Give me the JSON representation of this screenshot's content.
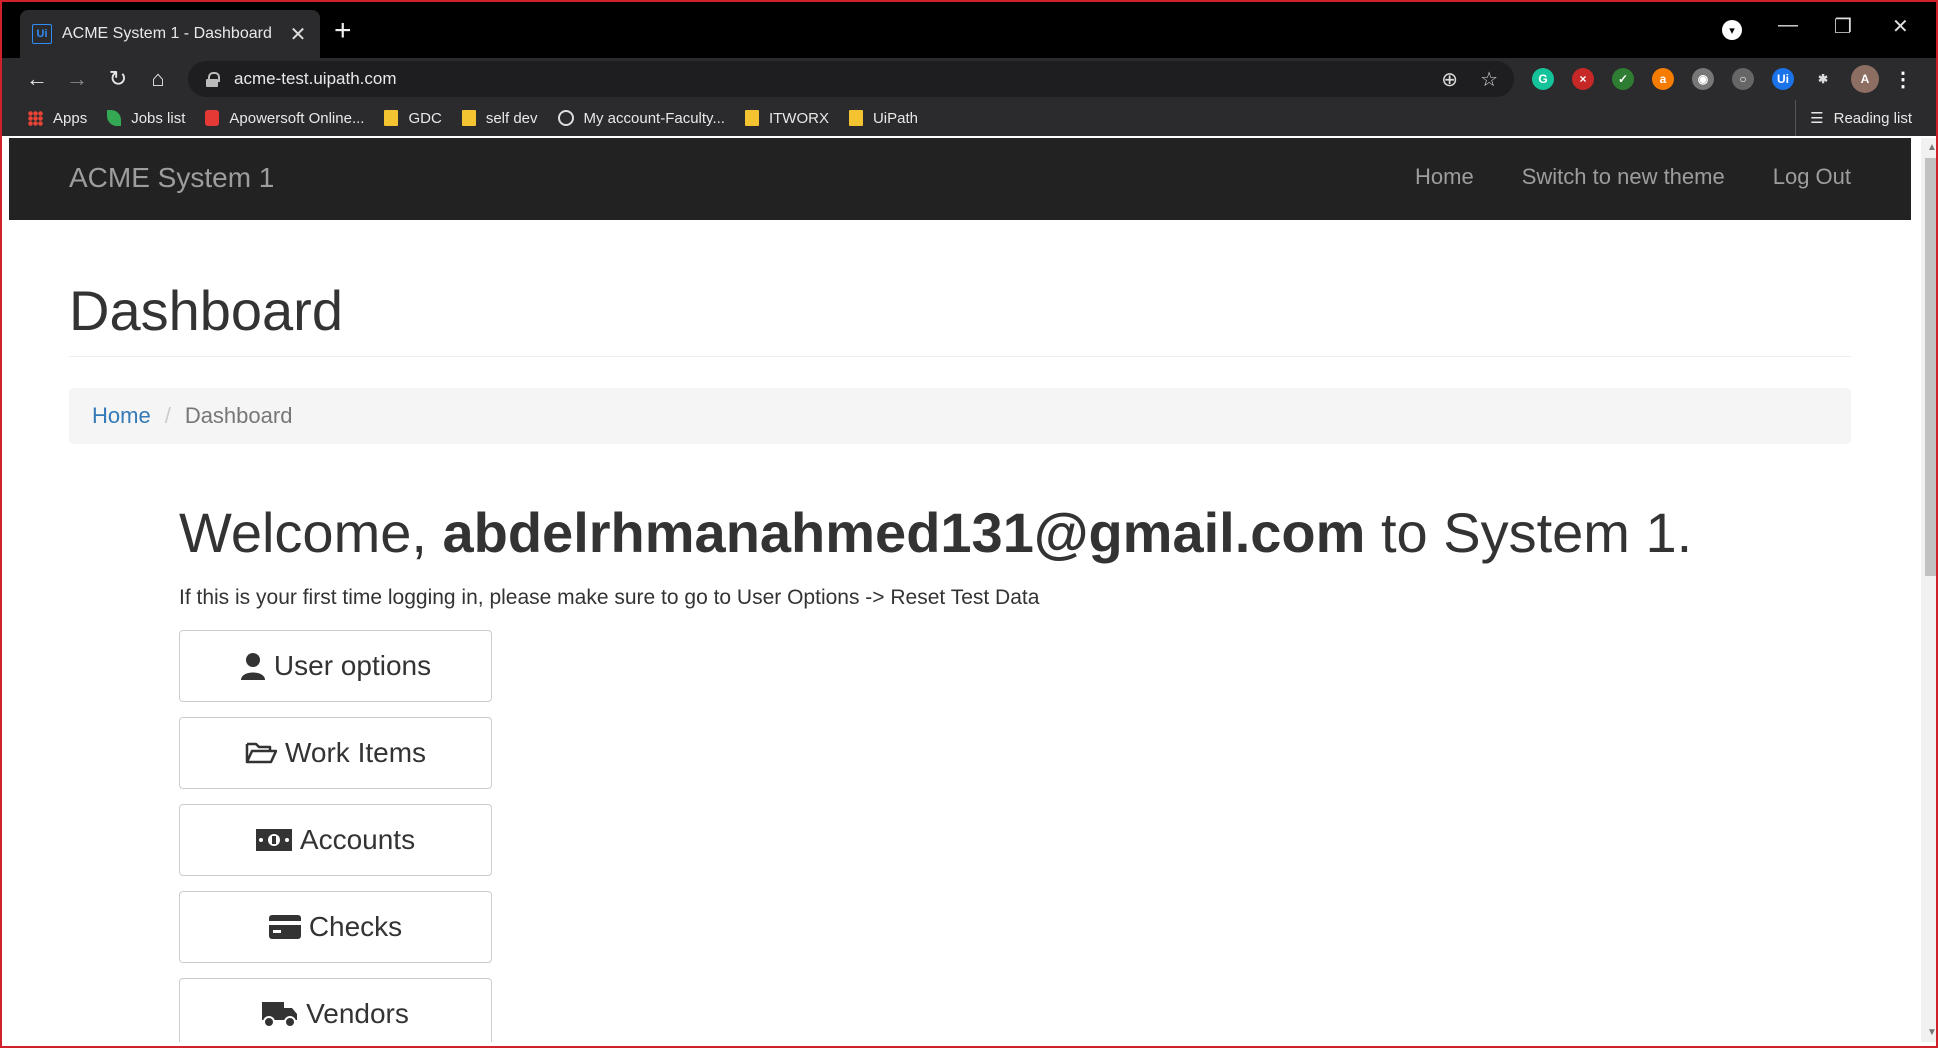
{
  "browser": {
    "tab_title": "ACME System 1 - Dashboard",
    "tab_favicon": "Ui",
    "new_tab": "+",
    "close": "✕",
    "url": "acme-test.uipath.com",
    "profile_initial": "A",
    "extensions": [
      {
        "name": "grammarly-icon",
        "color": "#15c39a",
        "glyph": "G"
      },
      {
        "name": "block-extension-icon",
        "color": "#c62828",
        "glyph": "×"
      },
      {
        "name": "checkmark-extension-icon",
        "color": "#2e7d32",
        "glyph": "✓"
      },
      {
        "name": "shopping-bag-icon",
        "color": "#f57c00",
        "glyph": "a"
      },
      {
        "name": "camera-icon",
        "color": "#777",
        "glyph": "◉"
      },
      {
        "name": "circle-extension-icon",
        "color": "#666",
        "glyph": "○"
      },
      {
        "name": "uipath-extension-icon",
        "color": "#1a73e8",
        "glyph": "Ui"
      },
      {
        "name": "puzzle-extensions-icon",
        "color": "transparent",
        "glyph": "✱"
      }
    ],
    "bookmarks": [
      {
        "label": "Apps",
        "icon": "apps-grid-icon"
      },
      {
        "label": "Jobs list",
        "icon": "leaf-icon"
      },
      {
        "label": "Apowersoft Online...",
        "icon": "apowersoft-icon"
      },
      {
        "label": "GDC",
        "icon": "folder-icon"
      },
      {
        "label": "self dev",
        "icon": "folder-icon"
      },
      {
        "label": "My account-Faculty...",
        "icon": "globe-icon"
      },
      {
        "label": "ITWORX",
        "icon": "folder-icon"
      },
      {
        "label": "UiPath",
        "icon": "folder-icon"
      }
    ],
    "reading_list": "Reading list"
  },
  "app": {
    "brand": "ACME System 1",
    "nav": {
      "home": "Home",
      "switch_theme": "Switch to new theme",
      "logout": "Log Out"
    },
    "page_title": "Dashboard",
    "breadcrumb": {
      "home": "Home",
      "separator": "/",
      "current": "Dashboard"
    },
    "welcome": {
      "prefix": "Welcome,",
      "user": "abdelrhmanahmed131@gmail.com",
      "suffix": "to System 1."
    },
    "hint": "If this is your first time logging in, please make sure to go to User Options -> Reset Test Data",
    "buttons": {
      "user_options": "User options",
      "work_items": "Work Items",
      "accounts": "Accounts",
      "checks": "Checks",
      "vendors": "Vendors"
    }
  }
}
